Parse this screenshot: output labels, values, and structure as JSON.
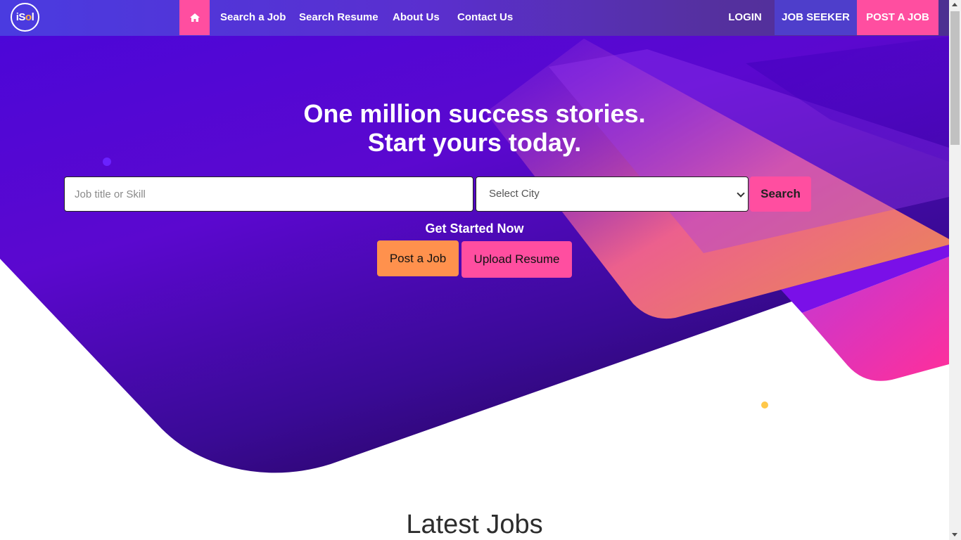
{
  "navbar": {
    "logo_text": "iSol",
    "links": [
      "Search a Job",
      "Search Resume",
      "About Us",
      "Contact Us"
    ],
    "login_label": "LOGIN",
    "job_seeker_label": "JOB SEEKER",
    "post_job_label": "POST A JOB",
    "home_icon": "home-icon"
  },
  "hero": {
    "headline_line1": "One million success stories.",
    "headline_line2": "Start yours today.",
    "search_placeholder": "Job title or Skill",
    "city_selected": "Select City",
    "search_button": "Search",
    "get_started": "Get Started Now",
    "post_job_button": "Post a Job",
    "upload_resume_button": "Upload Resume"
  },
  "latest_jobs": {
    "title": "Latest Jobs"
  },
  "colors": {
    "accent_pink": "#ff4ea0",
    "accent_orange": "#ff914d",
    "hero_purple": "#4b06d6"
  }
}
